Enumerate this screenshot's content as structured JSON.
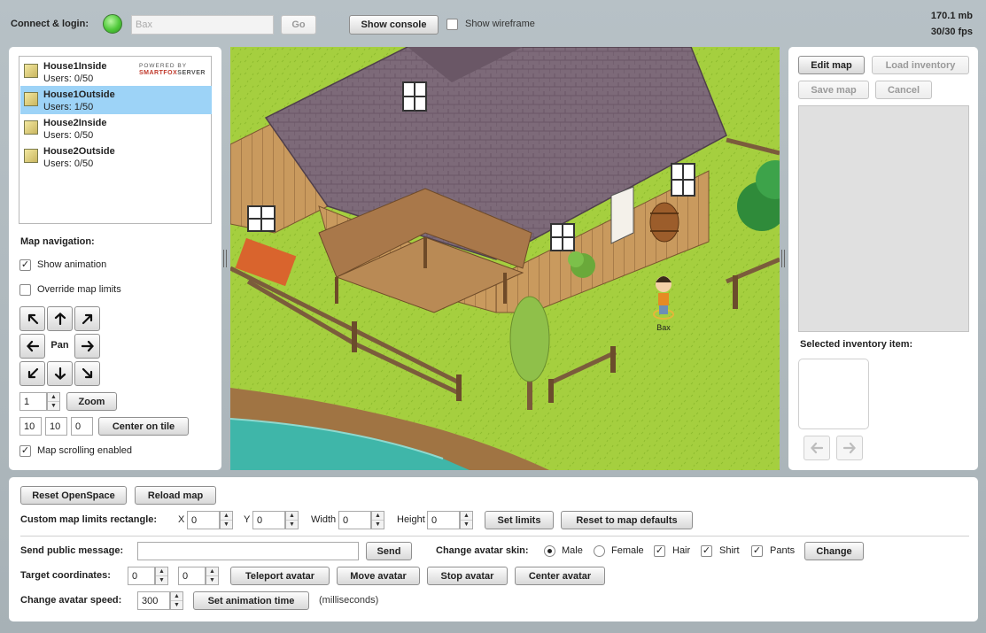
{
  "topbar": {
    "connect_label": "Connect & login:",
    "username_value": "Bax",
    "go_label": "Go",
    "show_console_label": "Show console",
    "show_wireframe_label": "Show wireframe",
    "memory": "170.1 mb",
    "fps": "30/30 fps",
    "status_color": "#4fc93a"
  },
  "rooms": [
    {
      "name": "House1Inside",
      "users": "Users: 0/50",
      "selected": false
    },
    {
      "name": "House1Outside",
      "users": "Users: 1/50",
      "selected": true
    },
    {
      "name": "House2Inside",
      "users": "Users: 0/50",
      "selected": false
    },
    {
      "name": "House2Outside",
      "users": "Users: 0/50",
      "selected": false
    }
  ],
  "branding": {
    "line1": "POWERED BY",
    "line2a": "SMARTFOX",
    "line2b": "SERVER"
  },
  "map_nav": {
    "title": "Map navigation:",
    "show_animation_label": "Show animation",
    "show_animation_checked": true,
    "override_limits_label": "Override map limits",
    "override_limits_checked": false,
    "pan_label": "Pan",
    "zoom_value": "1",
    "zoom_label": "Zoom",
    "tile_x": "10",
    "tile_y": "10",
    "tile_z": "0",
    "center_label": "Center on tile",
    "scrolling_label": "Map scrolling enabled",
    "scrolling_checked": true
  },
  "scene": {
    "avatar_name": "Bax"
  },
  "editor": {
    "edit_map_label": "Edit map",
    "load_inventory_label": "Load inventory",
    "save_map_label": "Save map",
    "cancel_label": "Cancel",
    "selected_item_label": "Selected inventory item:"
  },
  "bottom": {
    "reset_openspace_label": "Reset OpenSpace",
    "reload_map_label": "Reload map",
    "limits_label": "Custom map limits rectangle:",
    "x_label": "X",
    "x_value": "0",
    "y_label": "Y",
    "y_value": "0",
    "width_label": "Width",
    "width_value": "0",
    "height_label": "Height",
    "height_value": "0",
    "set_limits_label": "Set limits",
    "reset_defaults_label": "Reset to map defaults",
    "public_msg_label": "Send public message:",
    "public_msg_value": "",
    "send_label": "Send",
    "skin_label": "Change avatar skin:",
    "male_label": "Male",
    "female_label": "Female",
    "hair_label": "Hair",
    "shirt_label": "Shirt",
    "pants_label": "Pants",
    "change_label": "Change",
    "target_label": "Target coordinates:",
    "target_x": "0",
    "target_y": "0",
    "teleport_label": "Teleport avatar",
    "move_label": "Move avatar",
    "stop_label": "Stop avatar",
    "center_avatar_label": "Center avatar",
    "speed_label": "Change avatar speed:",
    "speed_value": "300",
    "set_anim_label": "Set animation time",
    "ms_label": "(milliseconds)"
  }
}
